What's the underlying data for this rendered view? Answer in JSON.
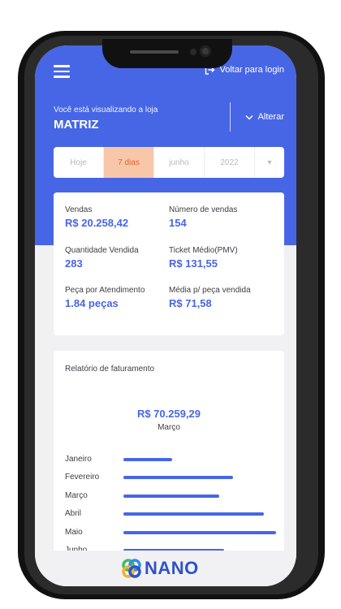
{
  "header": {
    "login_link": "Voltar para login"
  },
  "store": {
    "label": "Você está visualizando a loja",
    "name": "MATRIZ",
    "change_label": "Alterar"
  },
  "filter": {
    "options": [
      "Hoje",
      "7 dias",
      "junho",
      "2022",
      "▾"
    ],
    "selected": "7 dias"
  },
  "stats": [
    {
      "label": "Vendas",
      "value": "R$ 20.258,42"
    },
    {
      "label": "Número de vendas",
      "value": "154"
    },
    {
      "label": "Quantidade Vendida",
      "value": "283"
    },
    {
      "label": "Ticket Médio(PMV)",
      "value": "R$ 131,55"
    },
    {
      "label": "Peça por Atendimento",
      "value": "1.84 peças"
    },
    {
      "label": "Média p/ peça vendida",
      "value": "R$ 71,58"
    }
  ],
  "report": {
    "title": "Relatório de faturamento",
    "highlight_value": "R$ 70.259,29",
    "highlight_month": "Março",
    "months": [
      {
        "name": "Janeiro",
        "fraction": 0.32
      },
      {
        "name": "Fevereiro",
        "fraction": 0.72
      },
      {
        "name": "Março",
        "fraction": 0.63
      },
      {
        "name": "Abril",
        "fraction": 0.92
      },
      {
        "name": "Maio",
        "fraction": 1.0
      },
      {
        "name": "Junho",
        "fraction": 0.66
      }
    ]
  },
  "footer": {
    "logo_text": "NANO"
  },
  "colors": {
    "primary": "#4766e6",
    "accent": "#e2642a",
    "accent_bg": "#f8c7aa",
    "background": "#f1f1f3"
  }
}
